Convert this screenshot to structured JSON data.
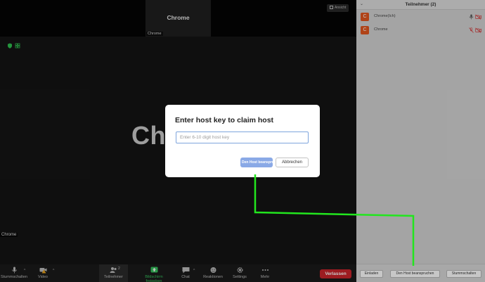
{
  "stage": {
    "thumb_title": "Chrome",
    "thumb_name": "Chrome",
    "view_button": "Ansicht",
    "speaker_name": "Chrom",
    "tile_name": "Chrome"
  },
  "toolbar": {
    "mute": "Stummschalten",
    "video": "Video",
    "participants": "Teilnehmer",
    "participants_count": "2",
    "share": "Bildschirm freigeben",
    "chat": "Chat",
    "reactions": "Reaktionen",
    "settings": "Settings",
    "more": "Mehr",
    "leave": "Verlassen"
  },
  "panel": {
    "title": "Teilnehmer (2)",
    "participants": [
      {
        "initial": "C",
        "name": "Chrome(Ich)"
      },
      {
        "initial": "C",
        "name": "Chrome"
      }
    ],
    "footer": {
      "invite": "Einladen",
      "claim_host": "Den Host beanspruchen",
      "mute_all": "Stummschalten"
    }
  },
  "modal": {
    "title": "Enter host key to claim host",
    "input_placeholder": "Enter 6-10 digit host key",
    "input_value": "",
    "claim_button": "Den Host beanspruchen",
    "cancel_button": "Abbrechen"
  },
  "colors": {
    "accent_blue": "#8aa9e6",
    "leave_red": "#c9252b",
    "avatar_orange": "#e2571e",
    "annotation_green": "#22e61e",
    "share_green": "#35c05b"
  }
}
